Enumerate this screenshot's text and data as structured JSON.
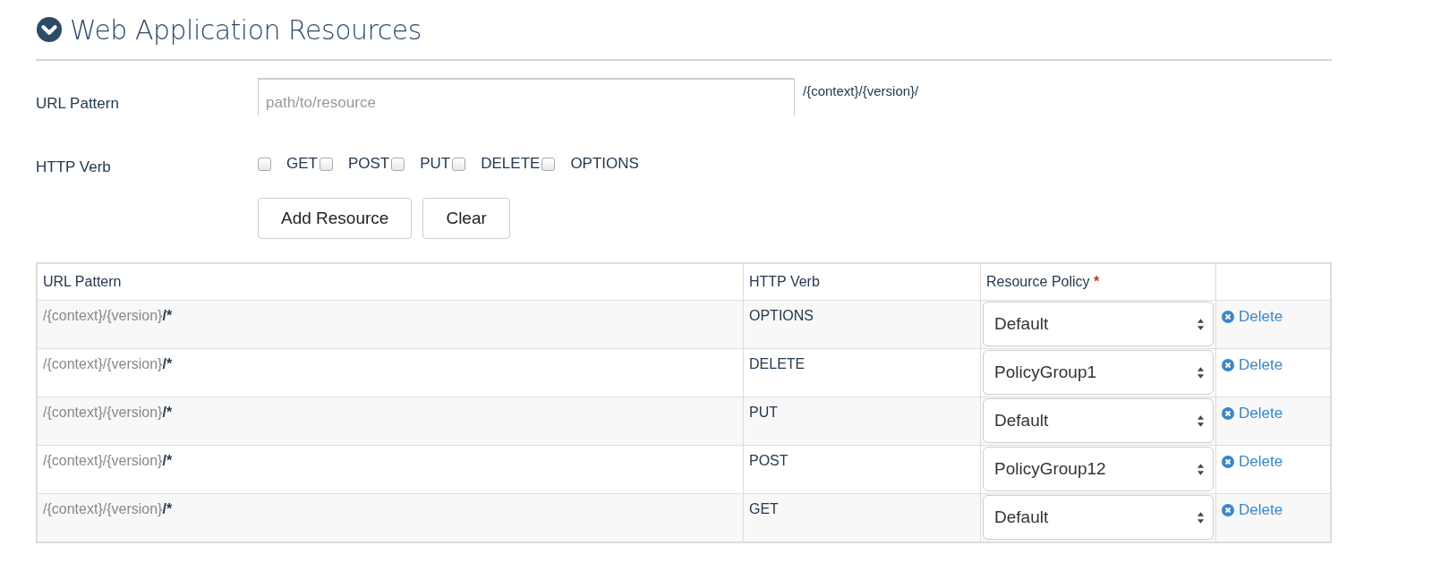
{
  "section": {
    "title": "Web Application Resources",
    "expanded": true
  },
  "form": {
    "url_label": "URL Pattern",
    "url_placeholder": "path/to/resource",
    "url_suffix": "/{context}/{version}/",
    "verb_label": "HTTP Verb",
    "verbs": [
      {
        "label": "GET",
        "checked": false
      },
      {
        "label": "POST",
        "checked": false
      },
      {
        "label": "PUT",
        "checked": false
      },
      {
        "label": "DELETE",
        "checked": false
      },
      {
        "label": "OPTIONS",
        "checked": false
      }
    ],
    "buttons": [
      "Add Resource",
      "Clear"
    ]
  },
  "table": {
    "columns": [
      "URL Pattern",
      "HTTP Verb",
      "Resource Policy"
    ],
    "required_mark": "*",
    "rows": [
      {
        "url_prefix": "/{context}/{version}",
        "url_suffix": "/*",
        "verb": "OPTIONS",
        "policy": "Default",
        "action": "Delete"
      },
      {
        "url_prefix": "/{context}/{version}",
        "url_suffix": "/*",
        "verb": "DELETE",
        "policy": "PolicyGroup1",
        "action": "Delete"
      },
      {
        "url_prefix": "/{context}/{version}",
        "url_suffix": "/*",
        "verb": "PUT",
        "policy": "Default",
        "action": "Delete"
      },
      {
        "url_prefix": "/{context}/{version}",
        "url_suffix": "/*",
        "verb": "POST",
        "policy": "PolicyGroup12",
        "action": "Delete"
      },
      {
        "url_prefix": "/{context}/{version}",
        "url_suffix": "/*",
        "verb": "GET",
        "policy": "Default",
        "action": "Delete"
      }
    ]
  }
}
